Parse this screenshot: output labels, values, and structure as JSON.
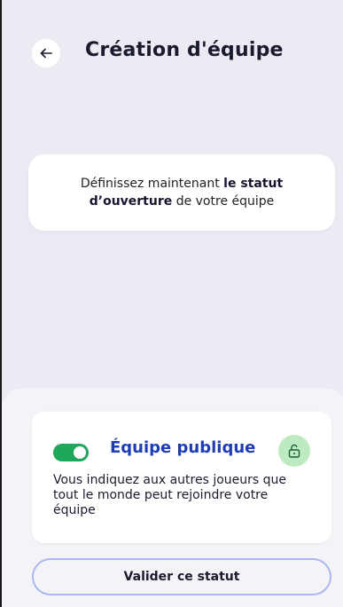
{
  "header": {
    "title": "Création d'équipe",
    "back_icon": "arrow-left-icon"
  },
  "info_card": {
    "text_prefix": "Définissez maintenant ",
    "text_bold": "le statut d’ouverture",
    "text_suffix": " de votre équipe"
  },
  "status_card": {
    "toggle_on": true,
    "title": "Équipe publique",
    "description": "Vous indiquez aux autres joueurs que tout le monde peut rejoindre votre équipe",
    "lock_icon": "unlock-icon"
  },
  "validate_button": {
    "label": "Valider ce statut"
  },
  "colors": {
    "background": "#ECEBF3",
    "sheet": "#F4F4F8",
    "title_blue": "#1E3CB4",
    "toggle_green": "#1FA85C",
    "lock_badge_green": "#BCEBC2",
    "button_border": "#A9B8EE"
  }
}
